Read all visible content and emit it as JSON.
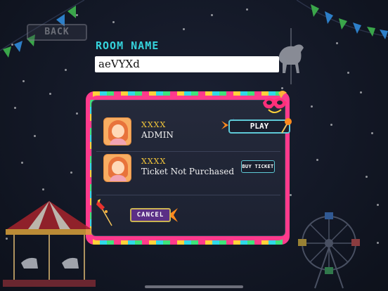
{
  "header": {
    "back_label": "BACK",
    "room_name_label": "ROOM NAME"
  },
  "room_name_input": {
    "value": "aeVYXd"
  },
  "dialog": {
    "players": [
      {
        "name": "XXXX",
        "status": "ADMIN",
        "action_label": "PLAY"
      },
      {
        "name": "XXXX",
        "status": "Ticket Not Purchased",
        "action_label": "BUY TICKET"
      }
    ],
    "cancel_label": "CANCEL"
  },
  "colors": {
    "accent_cyan": "#35d3dc",
    "player_name_gold": "#f7c93a",
    "cancel_purple": "#5b2f86"
  }
}
